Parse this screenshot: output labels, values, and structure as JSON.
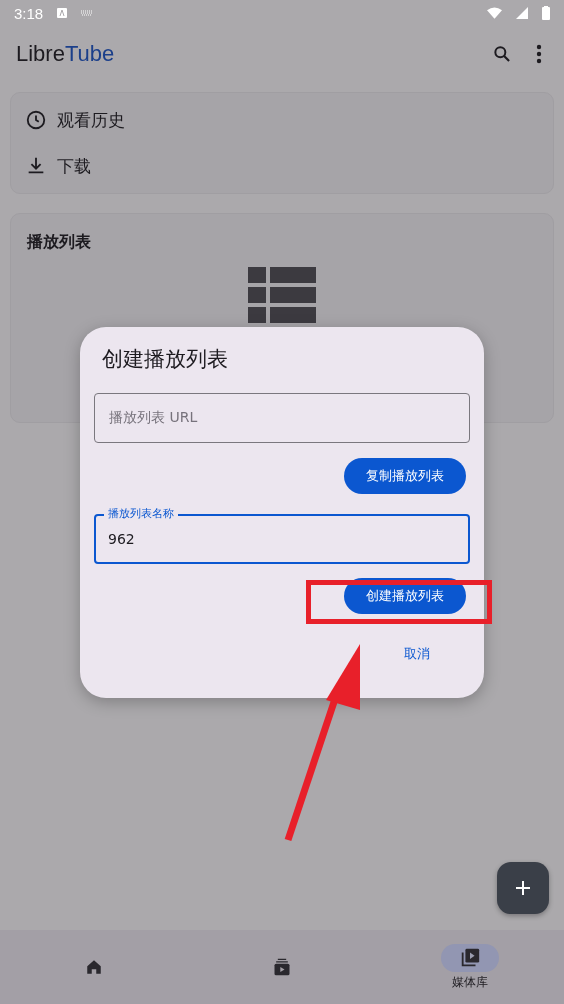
{
  "status_bar": {
    "time": "3:18"
  },
  "app_bar": {
    "logo": {
      "part_1": "Libre",
      "part_2": "Tube"
    }
  },
  "quick_links": [
    {
      "kind": "history",
      "label": "观看历史"
    },
    {
      "kind": "download",
      "label": "下载"
    }
  ],
  "playlists": {
    "title": "播放列表"
  },
  "dialog": {
    "title": "创建播放列表",
    "url_field": {
      "placeholder": "播放列表 URL"
    },
    "clone_button": "复制播放列表",
    "name_field": {
      "label": "播放列表名称",
      "value": "962"
    },
    "create_button": "创建播放列表",
    "cancel_button": "取消"
  },
  "bottom_nav": [
    {
      "kind": "home",
      "selected": false
    },
    {
      "kind": "subscriptions",
      "selected": false
    },
    {
      "kind": "library",
      "selected": true,
      "label": "媒体库"
    }
  ]
}
